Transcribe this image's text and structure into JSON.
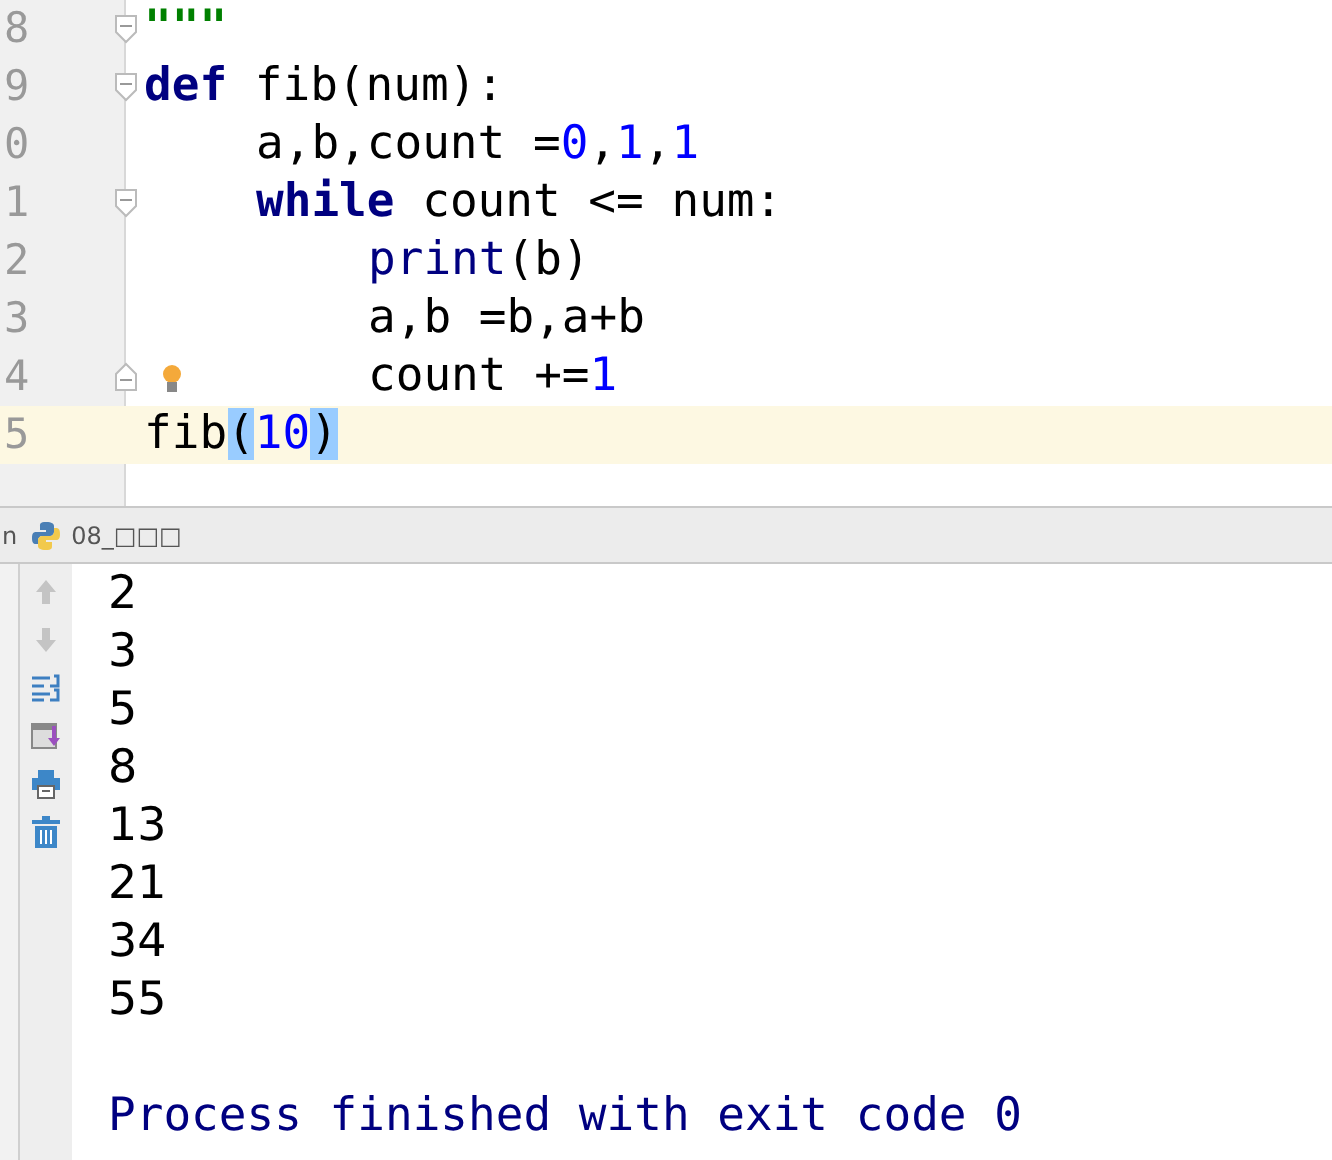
{
  "editor": {
    "lines": [
      {
        "number": "8",
        "kind": "block-start",
        "bulb": false,
        "current": false,
        "tokens": [
          {
            "text": "\"\"\"",
            "kind": "string"
          }
        ]
      },
      {
        "number": "9",
        "kind": "block-start",
        "bulb": false,
        "current": false,
        "tokens": [
          {
            "text": "def",
            "kind": "keyword"
          },
          {
            "text": " fib(num):",
            "kind": "plain"
          }
        ],
        "children": [
          {
            "number": "0",
            "kind": "plain",
            "bulb": false,
            "current": false,
            "tokens": [
              {
                "text": "a,b,count =",
                "kind": "plain"
              },
              {
                "text": "0",
                "kind": "number"
              },
              {
                "text": ",",
                "kind": "plain"
              },
              {
                "text": "1",
                "kind": "number"
              },
              {
                "text": ",",
                "kind": "plain"
              },
              {
                "text": "1",
                "kind": "number"
              }
            ]
          },
          {
            "number": "1",
            "kind": "block-start",
            "bulb": false,
            "current": false,
            "tokens": [
              {
                "text": "while",
                "kind": "keyword"
              },
              {
                "text": " count <= num:",
                "kind": "plain"
              }
            ],
            "children": [
              {
                "number": "2",
                "kind": "plain",
                "bulb": false,
                "current": false,
                "tokens": [
                  {
                    "text": "print",
                    "kind": "builtin"
                  },
                  {
                    "text": "(b)",
                    "kind": "plain"
                  }
                ]
              },
              {
                "number": "3",
                "kind": "plain",
                "bulb": false,
                "current": false,
                "tokens": [
                  {
                    "text": "a,b =b,a+b",
                    "kind": "plain"
                  }
                ]
              },
              {
                "number": "4",
                "kind": "block-end",
                "bulb": true,
                "current": false,
                "tokens": [
                  {
                    "text": "count +=",
                    "kind": "plain"
                  },
                  {
                    "text": "1",
                    "kind": "number"
                  }
                ]
              }
            ]
          }
        ]
      },
      {
        "number": "5",
        "kind": "plain",
        "bulb": false,
        "current": true,
        "tokens": [
          {
            "text": "fib",
            "kind": "plain"
          },
          {
            "text": "(",
            "kind": "brace"
          },
          {
            "text": "10",
            "kind": "number"
          },
          {
            "text": ")",
            "kind": "brace"
          }
        ]
      }
    ]
  },
  "run_panel": {
    "label": "n",
    "tab_title": "08_□□□"
  },
  "console": {
    "output": [
      "2",
      "3",
      "5",
      "8",
      "13",
      "21",
      "34",
      "55"
    ],
    "exit_message": "Process finished with exit code 0"
  }
}
